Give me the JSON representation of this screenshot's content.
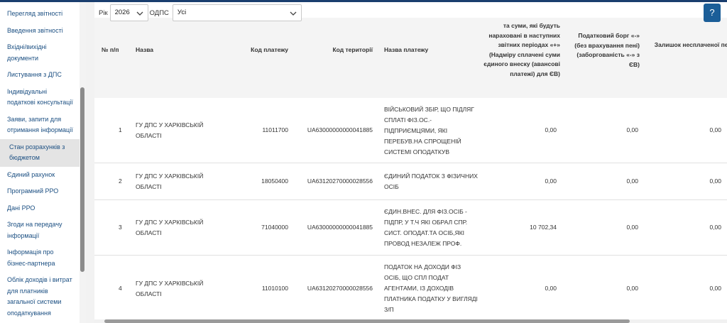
{
  "sidebar": {
    "items": [
      {
        "label": "Перегляд звітності"
      },
      {
        "label": "Введення звітності"
      },
      {
        "label": "Вхідні/вихідні документи"
      },
      {
        "label": "Листування з ДПС"
      },
      {
        "label": "Індивідуальні податкові консультації"
      },
      {
        "label": "Заяви, запити для отримання інформації"
      },
      {
        "label": "Стан розрахунків з бюджетом"
      },
      {
        "label": "Єдиний рахунок"
      },
      {
        "label": "Програмний РРО"
      },
      {
        "label": "Дані РРО"
      },
      {
        "label": "Згоди на передачу інформації"
      },
      {
        "label": "Інформація про бізнес-партнера"
      },
      {
        "label": "Облік доходів і витрат для платників загальної системи оподаткування"
      }
    ],
    "active_index": 6
  },
  "filters": {
    "year_label": "Рік",
    "year_value": "2026",
    "odps_label": "ОДПС",
    "odps_value": "Усі"
  },
  "help_label": "?",
  "table": {
    "headers": {
      "num": "№ п/п",
      "name": "Назва",
      "payment_code": "Код платежу",
      "territory_code": "Код території",
      "payment_name": "Назва платежу",
      "future_amounts": "та суми, які будуть нараховані в наступних звітних періодах «+» (Надміру сплачені суми єдиного внеску (авансові платежі) для ЄВ)",
      "tax_debt": "Податковий борг «-» (без врахування пені) (заборгованість «-» з ЄВ)",
      "unpaid_penalty": "Залишок несплаченої пені"
    },
    "rows": [
      {
        "num": "1",
        "name": "ГУ ДПС У ХАРКІВСЬКІЙ ОБЛАСТІ",
        "payment_code": "11011700",
        "territory_code": "UA63000000000041885",
        "payment_name": "ВІЙСЬКОВИЙ ЗБІР, ЩО ПІДЛЯГ СПЛАТІ ФІЗ.ОС.-ПІДПРИЄМЦЯМИ, ЯКІ ПЕРЕБУВ.НА СПРОЩЕНІЙ СИСТЕМІ ОПОДАТКУВ",
        "future_amounts": "0,00",
        "tax_debt": "0,00",
        "unpaid_penalty": "0,00"
      },
      {
        "num": "2",
        "name": "ГУ ДПС У ХАРКІВСЬКІЙ ОБЛАСТІ",
        "payment_code": "18050400",
        "territory_code": "UA63120270000028556",
        "payment_name": "ЄДИНИЙ ПОДАТОК З ФІЗИЧНИХ ОСІБ",
        "future_amounts": "0,00",
        "tax_debt": "0,00",
        "unpaid_penalty": "0,00"
      },
      {
        "num": "3",
        "name": "ГУ ДПС У ХАРКІВСЬКІЙ ОБЛАСТІ",
        "payment_code": "71040000",
        "territory_code": "UA63000000000041885",
        "payment_name": "ЄДИН.ВНЕС. ДЛЯ ФІЗ.ОСІБ - ПІДПР, У Т.Ч ЯКІ ОБРАЛ СПР. СИСТ. ОПОДАТ.ТА ОСІБ,ЯКІ ПРОВОД НЕЗАЛЕЖ ПРОФ.",
        "future_amounts": "10 702,34",
        "tax_debt": "0,00",
        "unpaid_penalty": "0,00"
      },
      {
        "num": "4",
        "name": "ГУ ДПС У ХАРКІВСЬКІЙ ОБЛАСТІ",
        "payment_code": "11010100",
        "territory_code": "UA63120270000028556",
        "payment_name": "ПОДАТОК НА ДОХОДИ ФІЗ ОСІБ, ЩО СПЛ ПОДАТ АГЕНТАМИ, ІЗ ДОХОДІВ ПЛАТНИКА ПОДАТКУ У ВИГЛЯДІ З/П",
        "future_amounts": "0,00",
        "tax_debt": "0,00",
        "unpaid_penalty": "0,00"
      }
    ]
  }
}
